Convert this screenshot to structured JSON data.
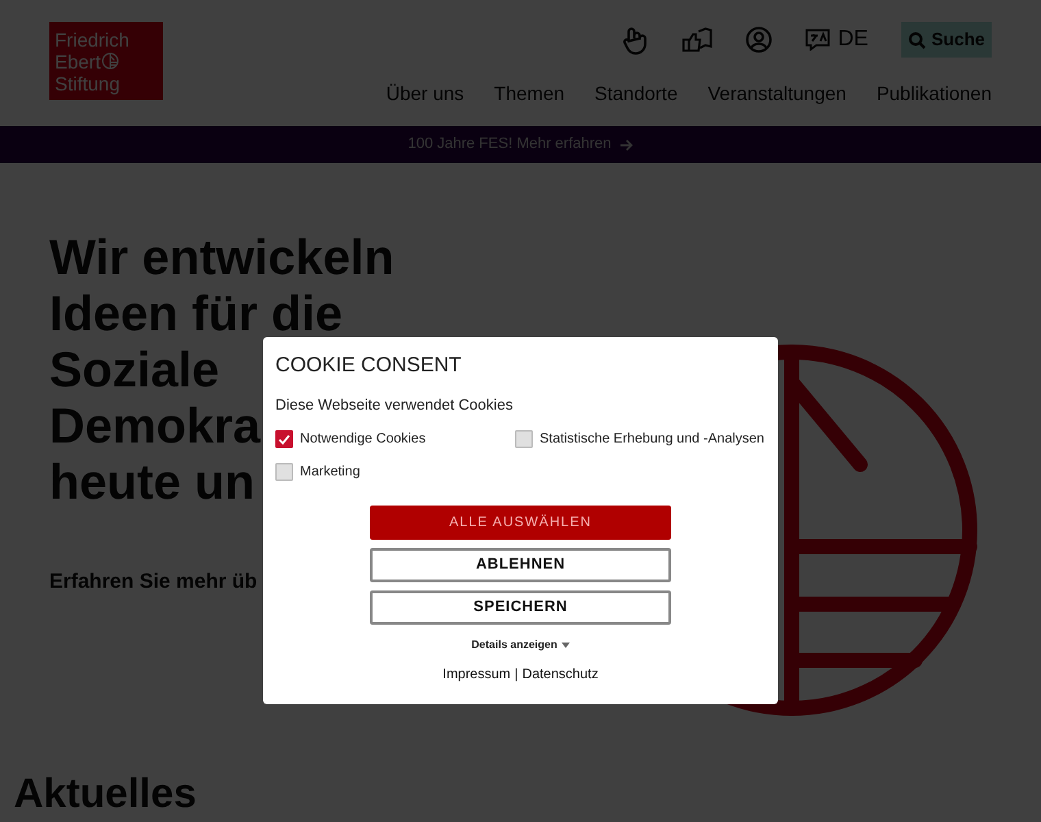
{
  "logo": {
    "lines": [
      "Friedrich",
      "Ebert",
      "Stiftung"
    ]
  },
  "header": {
    "language": "DE",
    "search_button": "Suche"
  },
  "nav": [
    "Über uns",
    "Themen",
    "Standorte",
    "Veranstaltungen",
    "Publikationen"
  ],
  "banner": {
    "text": "100 Jahre FES! Mehr erfahren"
  },
  "hero": {
    "heading_lines": [
      "Wir entwickeln",
      "Ideen für die",
      "Soziale",
      "Demokra",
      "heute un"
    ],
    "subtext": "Erfahren Sie mehr üb"
  },
  "section_heading": "Aktuelles",
  "cookie_dialog": {
    "title": "COOKIE CONSENT",
    "intro": "Diese Webseite verwendet Cookies",
    "options": [
      {
        "label": "Notwendige Cookies",
        "checked": true
      },
      {
        "label": "Statistische Erhebung und -Analysen",
        "checked": false
      },
      {
        "label": "Marketing",
        "checked": false
      }
    ],
    "buttons": [
      {
        "label": "ALLE AUSWÄHLEN",
        "kind": "primary"
      },
      {
        "label": "ABLEHNEN",
        "kind": "outline"
      },
      {
        "label": "SPEICHERN",
        "kind": "outline"
      }
    ],
    "details_link": "Details anzeigen",
    "footer_links": [
      "Impressum",
      "Datenschutz"
    ],
    "footer_separator": "|"
  }
}
